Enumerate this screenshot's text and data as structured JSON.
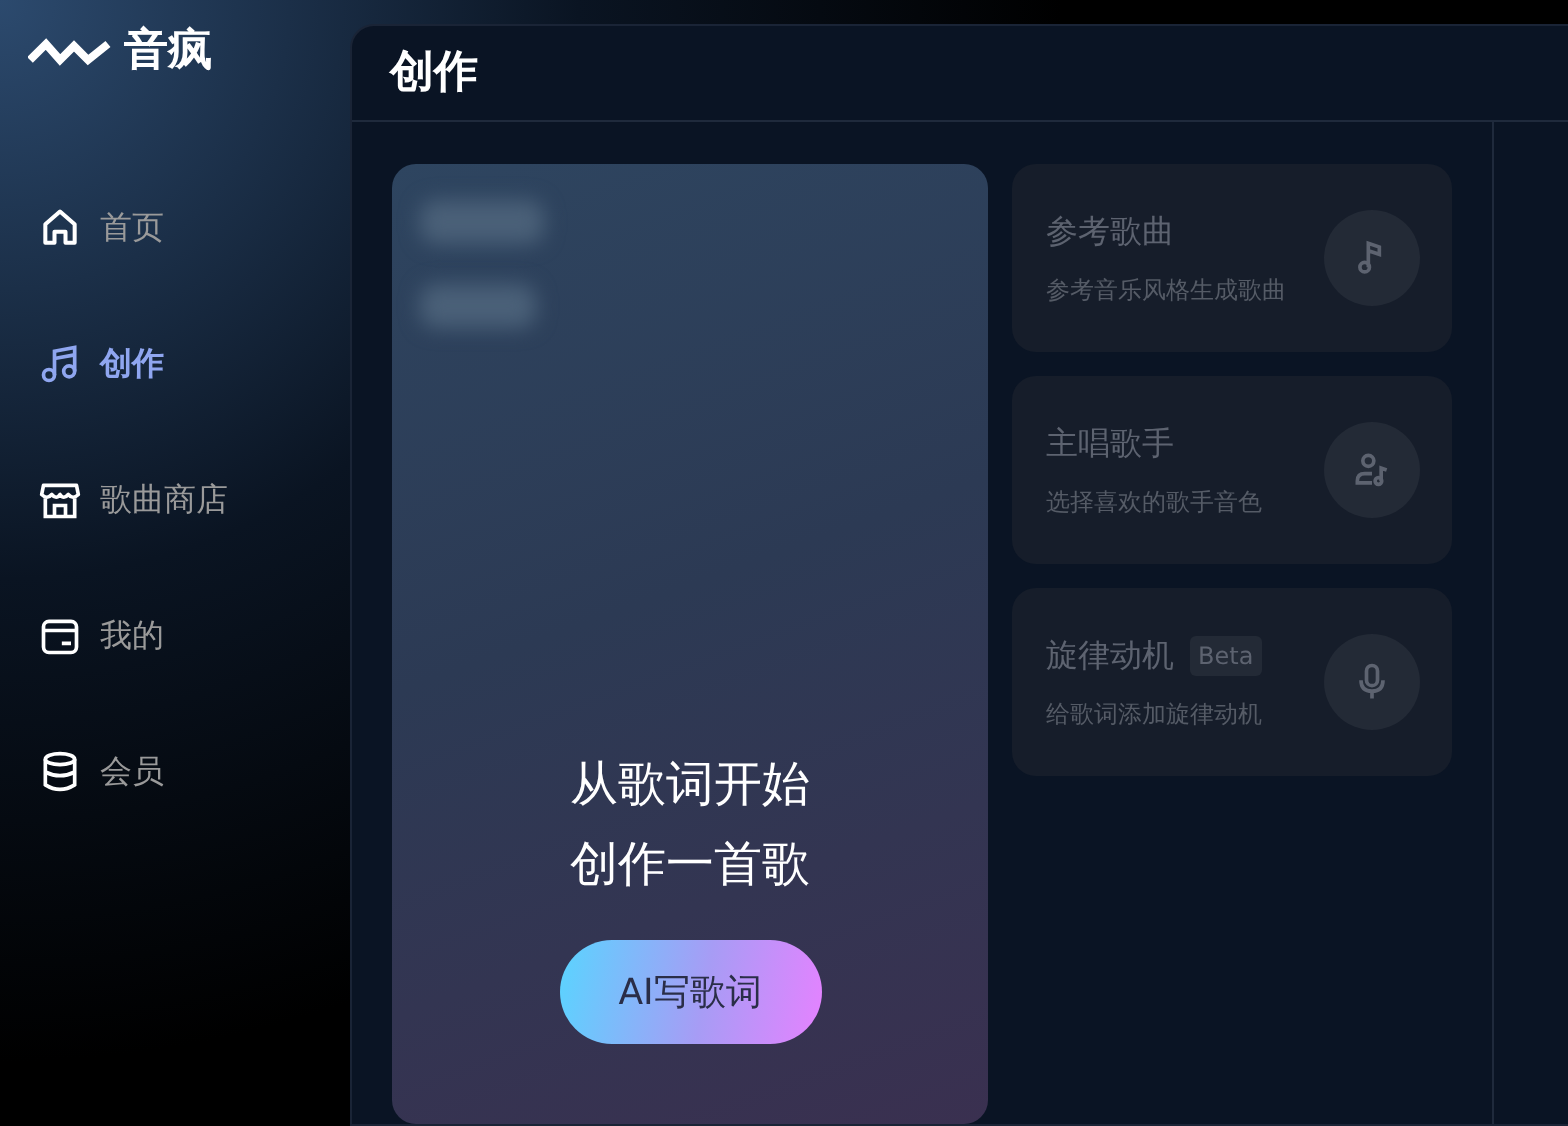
{
  "brand": {
    "name": "音疯"
  },
  "nav": [
    {
      "label": "首页",
      "selected": false
    },
    {
      "label": "创作",
      "selected": true
    },
    {
      "label": "歌曲商店",
      "selected": false
    },
    {
      "label": "我的",
      "selected": false
    },
    {
      "label": "会员",
      "selected": false
    }
  ],
  "page": {
    "title": "创作"
  },
  "hero": {
    "headline": [
      "从歌词开始",
      "创作一首歌"
    ],
    "button": "AI写歌词"
  },
  "features": [
    {
      "title": "参考歌曲",
      "subtitle": "参考音乐风格生成歌曲"
    },
    {
      "title": "主唱歌手",
      "subtitle": "选择喜欢的歌手音色"
    },
    {
      "title": "旋律动机",
      "badge": "Beta",
      "subtitle": "给歌词添加旋律动机"
    }
  ]
}
